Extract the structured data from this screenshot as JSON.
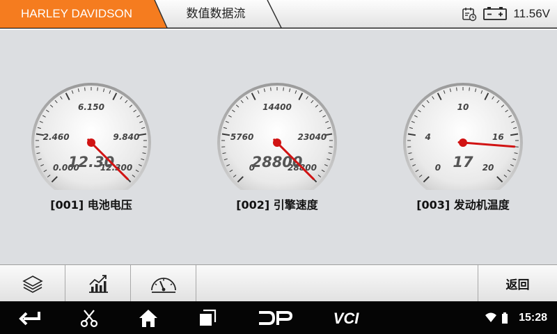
{
  "header": {
    "breadcrumb": [
      "HARLEY DAVIDSON",
      "数值数据流"
    ],
    "voltage": "11.56V",
    "accent_color": "#f57c1f",
    "icons": [
      "calendar-clock-icon",
      "battery-icon"
    ]
  },
  "gauges": [
    {
      "label": "[001] 电池电压",
      "value_text": "12.30",
      "value": 12.3,
      "min": 0,
      "max": 12.3,
      "ticks": [
        "0.000",
        "2.460",
        "6.150",
        "9.840",
        "12.300"
      ],
      "tick_values": [
        0,
        2.46,
        6.15,
        9.84,
        12.3
      ]
    },
    {
      "label": "[002] 引擎速度",
      "value_text": "28800",
      "value": 28800,
      "min": 0,
      "max": 28800,
      "ticks": [
        "0",
        "5760",
        "14400",
        "23040",
        "28800"
      ],
      "tick_values": [
        0,
        5760,
        14400,
        23040,
        28800
      ]
    },
    {
      "label": "[003] 发动机温度",
      "value_text": "17",
      "value": 17,
      "min": 0,
      "max": 20,
      "ticks": [
        "0",
        "4",
        "10",
        "16",
        "20"
      ],
      "tick_values": [
        0,
        4,
        10,
        16,
        20
      ]
    }
  ],
  "toolbar": {
    "buttons": [
      "layers-icon",
      "chart-icon",
      "gauge-icon"
    ],
    "back_label": "返回"
  },
  "navbar": {
    "icons": [
      "back-arrow-icon",
      "scissors-icon",
      "home-icon",
      "recents-icon",
      "dp-logo-icon",
      "vci-logo-icon"
    ],
    "dp_text": "DP",
    "vci_text": "VCI",
    "time": "15:28"
  }
}
